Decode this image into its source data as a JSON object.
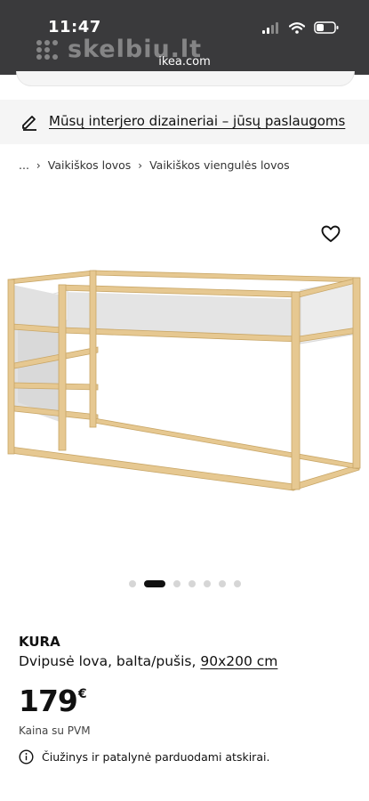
{
  "status_bar": {
    "time": "11:47",
    "url": "ikea.com"
  },
  "watermark": {
    "text": "skelbiu.lt"
  },
  "banner": {
    "link_text": "Mūsų interjero dizaineriai – jūsų paslaugoms",
    "icon": "pencil-icon"
  },
  "breadcrumb": {
    "ellipsis": "...",
    "items": [
      "Vaikiškos lovos",
      "Vaikiškos viengulės lovos"
    ]
  },
  "carousel": {
    "count": 7,
    "active_index": 1
  },
  "product": {
    "name": "KURA",
    "description": "Dvipusė lova, balta/pušis,",
    "size": "90x200 cm",
    "price": "179",
    "currency": "€",
    "vat_note": "Kaina su PVM",
    "notice": "Čiužinys ir patalynė parduodami atskirai."
  },
  "colors": {
    "status_bar_bg": "#3a3a3c",
    "banner_bg": "#f5f5f5",
    "wood": "#e6c891",
    "panel": "#e4e4e4"
  }
}
